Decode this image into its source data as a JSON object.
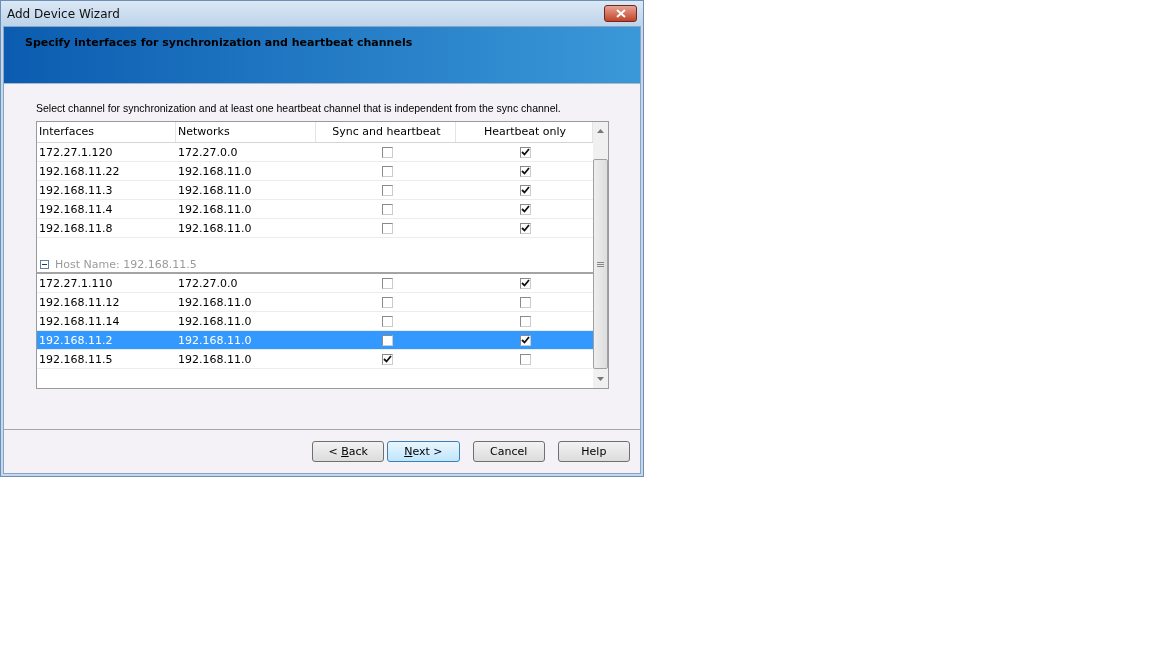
{
  "window": {
    "title": "Add Device Wizard"
  },
  "header": {
    "title": "Specify interfaces for synchronization and heartbeat channels"
  },
  "instruction": "Select channel for synchronization and at least one heartbeat channel that is independent from the sync channel.",
  "table": {
    "columns": [
      "Interfaces",
      "Networks",
      "Sync and heartbeat",
      "Heartbeat only"
    ],
    "groups": [
      {
        "rows": [
          {
            "interface": "172.27.1.120",
            "network": "172.27.0.0",
            "sync": false,
            "heartbeat": true,
            "selected": false
          },
          {
            "interface": "192.168.11.22",
            "network": "192.168.11.0",
            "sync": false,
            "heartbeat": true,
            "selected": false
          },
          {
            "interface": "192.168.11.3",
            "network": "192.168.11.0",
            "sync": false,
            "heartbeat": true,
            "selected": false
          },
          {
            "interface": "192.168.11.4",
            "network": "192.168.11.0",
            "sync": false,
            "heartbeat": true,
            "selected": false
          },
          {
            "interface": "192.168.11.8",
            "network": "192.168.11.0",
            "sync": false,
            "heartbeat": true,
            "selected": false
          }
        ]
      },
      {
        "header": "Host Name: 192.168.11.5",
        "expanded": true,
        "rows": [
          {
            "interface": "172.27.1.110",
            "network": "172.27.0.0",
            "sync": false,
            "heartbeat": true,
            "selected": false
          },
          {
            "interface": "192.168.11.12",
            "network": "192.168.11.0",
            "sync": false,
            "heartbeat": false,
            "selected": false
          },
          {
            "interface": "192.168.11.14",
            "network": "192.168.11.0",
            "sync": false,
            "heartbeat": false,
            "selected": false
          },
          {
            "interface": "192.168.11.2",
            "network": "192.168.11.0",
            "sync": false,
            "heartbeat": true,
            "selected": true
          },
          {
            "interface": "192.168.11.5",
            "network": "192.168.11.0",
            "sync": true,
            "heartbeat": false,
            "selected": false
          }
        ]
      }
    ]
  },
  "buttons": [
    {
      "before": "< ",
      "key": "B",
      "after": "ack",
      "default": false
    },
    {
      "key": "N",
      "after": "ext >",
      "default": true
    },
    {
      "before": "Cancel",
      "default": false
    },
    {
      "before": "Help",
      "default": false
    }
  ]
}
